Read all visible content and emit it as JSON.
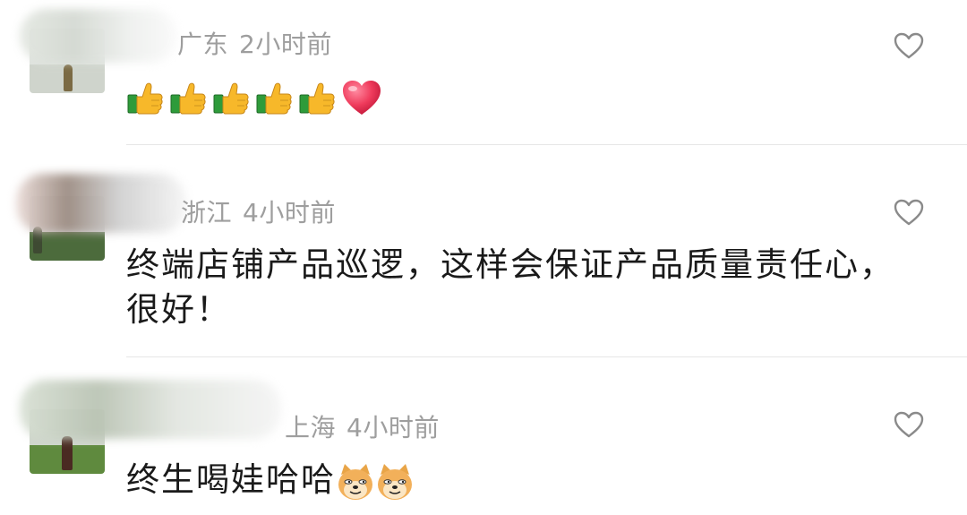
{
  "comments": [
    {
      "location": "广东",
      "time": "2小时前",
      "emoji_names": [
        "thumbs-up",
        "thumbs-up",
        "thumbs-up",
        "thumbs-up",
        "thumbs-up",
        "red-heart"
      ]
    },
    {
      "location": "浙江",
      "time": "4小时前",
      "text_line1": "终端店铺产品巡逻，这样会保证产品质量责任心，",
      "text_line2": "很好！"
    },
    {
      "location": "上海",
      "time": "4小时前",
      "text": "终生喝娃哈哈",
      "emoji_names": [
        "doge",
        "doge"
      ]
    }
  ],
  "icons": {
    "like": "heart-outline-icon"
  },
  "colors": {
    "meta_text": "#9e9e9e",
    "body_text": "#1a1a1a",
    "divider": "#e6e6e6",
    "heart_outline": "#8a8a8a"
  }
}
